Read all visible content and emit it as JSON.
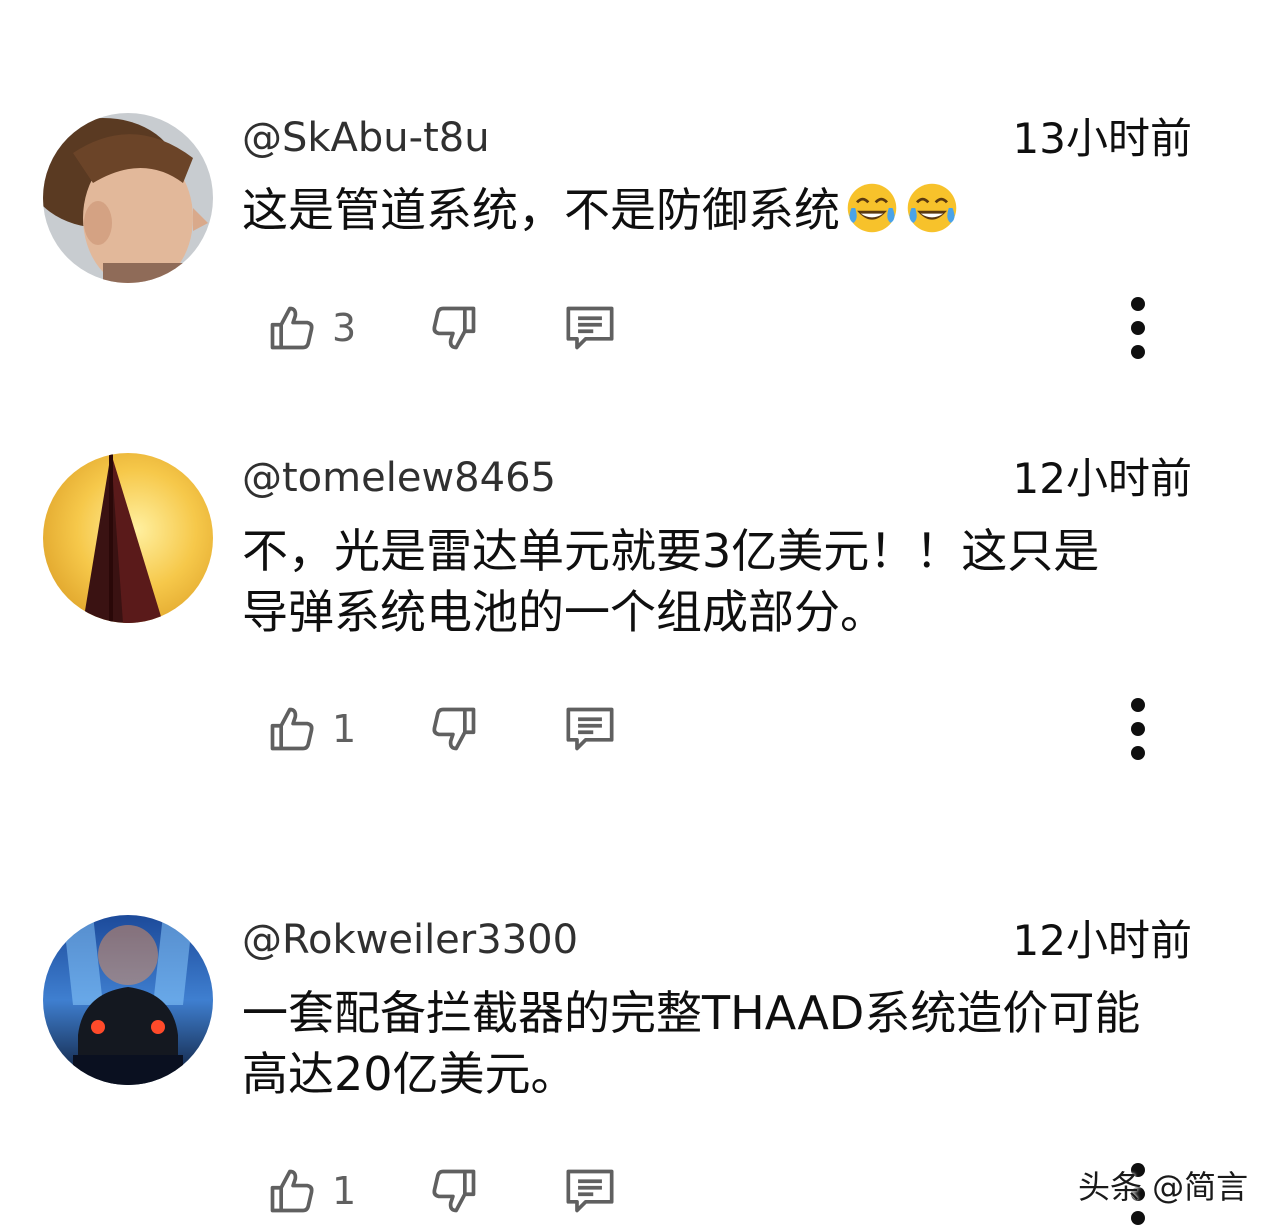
{
  "comments": [
    {
      "username": "@SkAbu-t8u",
      "time": "13小时前",
      "text": "这是管道系统，不是防御系统",
      "emoji": [
        "face-with-tears-of-joy",
        "face-with-tears-of-joy"
      ],
      "likes": "3",
      "avatar": "portrait-man"
    },
    {
      "username": "@tomelew8465",
      "time": "12小时前",
      "text": "不，光是雷达单元就要3亿美元！！这只是\n导弹系统电池的一个组成部分。",
      "likes": "1",
      "avatar": "sailboat-sunset"
    },
    {
      "username": "@Rokweiler3300",
      "time": "12小时前",
      "text": "一套配备拦截器的完整THAAD系统造价可能\n高达20亿美元。",
      "likes": "1",
      "avatar": "sports-car-rear"
    }
  ],
  "watermark": "头条 @简言",
  "colors": {
    "text": "#0f0f0f",
    "username": "#303030",
    "icon": "#606060",
    "background": "#ffffff"
  }
}
